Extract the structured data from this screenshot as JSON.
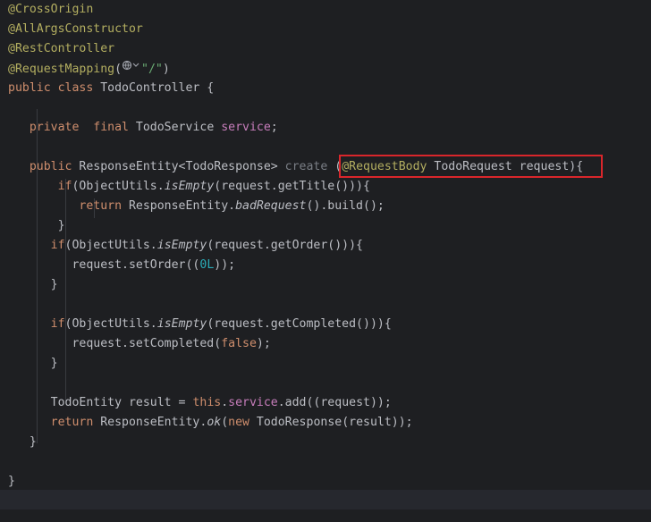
{
  "colors": {
    "background": "#1e1f22",
    "annotation": "#b3ae60",
    "keyword": "#cf8e6d",
    "field": "#c77dbb",
    "string": "#6aab73",
    "number": "#2aacb8",
    "default": "#bcbec4",
    "highlight_box": "#d9262b"
  },
  "lines": [
    [
      {
        "t": "@CrossOrigin",
        "c": "ann"
      }
    ],
    [
      {
        "t": "@AllArgsConstructor",
        "c": "ann"
      }
    ],
    [
      {
        "t": "@RestController",
        "c": "ann"
      }
    ],
    [
      {
        "t": "@RequestMapping",
        "c": "ann"
      },
      {
        "t": "("
      },
      {
        "icon": "globe-icon"
      },
      {
        "t": "\"/\"",
        "c": "str"
      },
      {
        "t": ")"
      }
    ],
    [
      {
        "t": "public class ",
        "c": "kw"
      },
      {
        "t": "TodoController {"
      }
    ],
    [],
    [
      {
        "t": "   "
      },
      {
        "t": "private  final ",
        "c": "kw"
      },
      {
        "t": "TodoService "
      },
      {
        "t": "service",
        "c": "fld"
      },
      {
        "t": ";"
      }
    ],
    [],
    [
      {
        "t": "   "
      },
      {
        "t": "public ",
        "c": "kw"
      },
      {
        "t": "ResponseEntity<TodoResponse> "
      },
      {
        "t": "create ",
        "c": "param"
      },
      {
        "t": "("
      },
      {
        "t": "@RequestBody",
        "c": "ann"
      },
      {
        "t": " TodoRequest request){"
      }
    ],
    [
      {
        "t": "       "
      },
      {
        "t": "if",
        "c": "kw"
      },
      {
        "t": "(ObjectUtils."
      },
      {
        "t": "isEmpty",
        "c": "it"
      },
      {
        "t": "(request.getTitle())){"
      }
    ],
    [
      {
        "t": "          "
      },
      {
        "t": "return ",
        "c": "kw"
      },
      {
        "t": "ResponseEntity."
      },
      {
        "t": "badRequest",
        "c": "it"
      },
      {
        "t": "().build();"
      }
    ],
    [
      {
        "t": "       }"
      }
    ],
    [
      {
        "t": "      "
      },
      {
        "t": "if",
        "c": "kw"
      },
      {
        "t": "(ObjectUtils."
      },
      {
        "t": "isEmpty",
        "c": "it"
      },
      {
        "t": "(request.getOrder())){"
      }
    ],
    [
      {
        "t": "         request.setOrder(("
      },
      {
        "t": "0L",
        "c": "num"
      },
      {
        "t": "));"
      }
    ],
    [
      {
        "t": "      }"
      }
    ],
    [],
    [
      {
        "t": "      "
      },
      {
        "t": "if",
        "c": "kw"
      },
      {
        "t": "(ObjectUtils."
      },
      {
        "t": "isEmpty",
        "c": "it"
      },
      {
        "t": "(request.getCompleted())){"
      }
    ],
    [
      {
        "t": "         request.setCompleted("
      },
      {
        "t": "false",
        "c": "kw"
      },
      {
        "t": ");"
      }
    ],
    [
      {
        "t": "      }"
      }
    ],
    [],
    [
      {
        "t": "      TodoEntity result = "
      },
      {
        "t": "this",
        "c": "kw"
      },
      {
        "t": "."
      },
      {
        "t": "service",
        "c": "fld"
      },
      {
        "t": ".add((request));"
      }
    ],
    [
      {
        "t": "      "
      },
      {
        "t": "return ",
        "c": "kw"
      },
      {
        "t": "ResponseEntity."
      },
      {
        "t": "ok",
        "c": "it"
      },
      {
        "t": "("
      },
      {
        "t": "new ",
        "c": "kw"
      },
      {
        "t": "TodoResponse(result));"
      }
    ],
    [
      {
        "t": "   }"
      }
    ],
    [],
    [
      {
        "t": "}"
      }
    ],
    []
  ]
}
